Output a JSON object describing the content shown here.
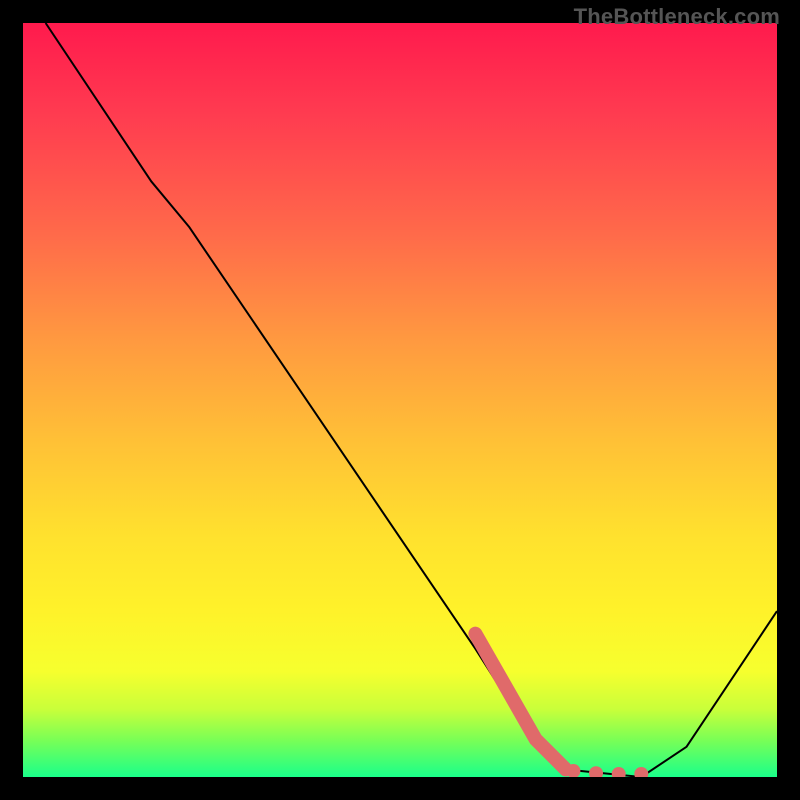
{
  "watermark": "TheBottleneck.com",
  "chart_data": {
    "type": "line",
    "title": "",
    "xlabel": "",
    "ylabel": "",
    "xlim": [
      0,
      100
    ],
    "ylim": [
      0,
      100
    ],
    "series": [
      {
        "name": "bottleneck-curve",
        "color": "#000000",
        "points": [
          {
            "x": 3,
            "y": 100
          },
          {
            "x": 17,
            "y": 79
          },
          {
            "x": 22,
            "y": 73
          },
          {
            "x": 60,
            "y": 17
          },
          {
            "x": 67,
            "y": 6
          },
          {
            "x": 72,
            "y": 1
          },
          {
            "x": 82,
            "y": 0
          },
          {
            "x": 88,
            "y": 4
          },
          {
            "x": 100,
            "y": 22
          }
        ]
      }
    ],
    "highlights": {
      "name": "highlight-segment",
      "color": "#e06a6a",
      "segment_points": [
        {
          "x": 60,
          "y": 19
        },
        {
          "x": 68,
          "y": 5
        },
        {
          "x": 72,
          "y": 1
        }
      ],
      "dots": [
        {
          "x": 73,
          "y": 0.8
        },
        {
          "x": 76,
          "y": 0.5
        },
        {
          "x": 79,
          "y": 0.4
        },
        {
          "x": 82,
          "y": 0.4
        }
      ]
    }
  }
}
